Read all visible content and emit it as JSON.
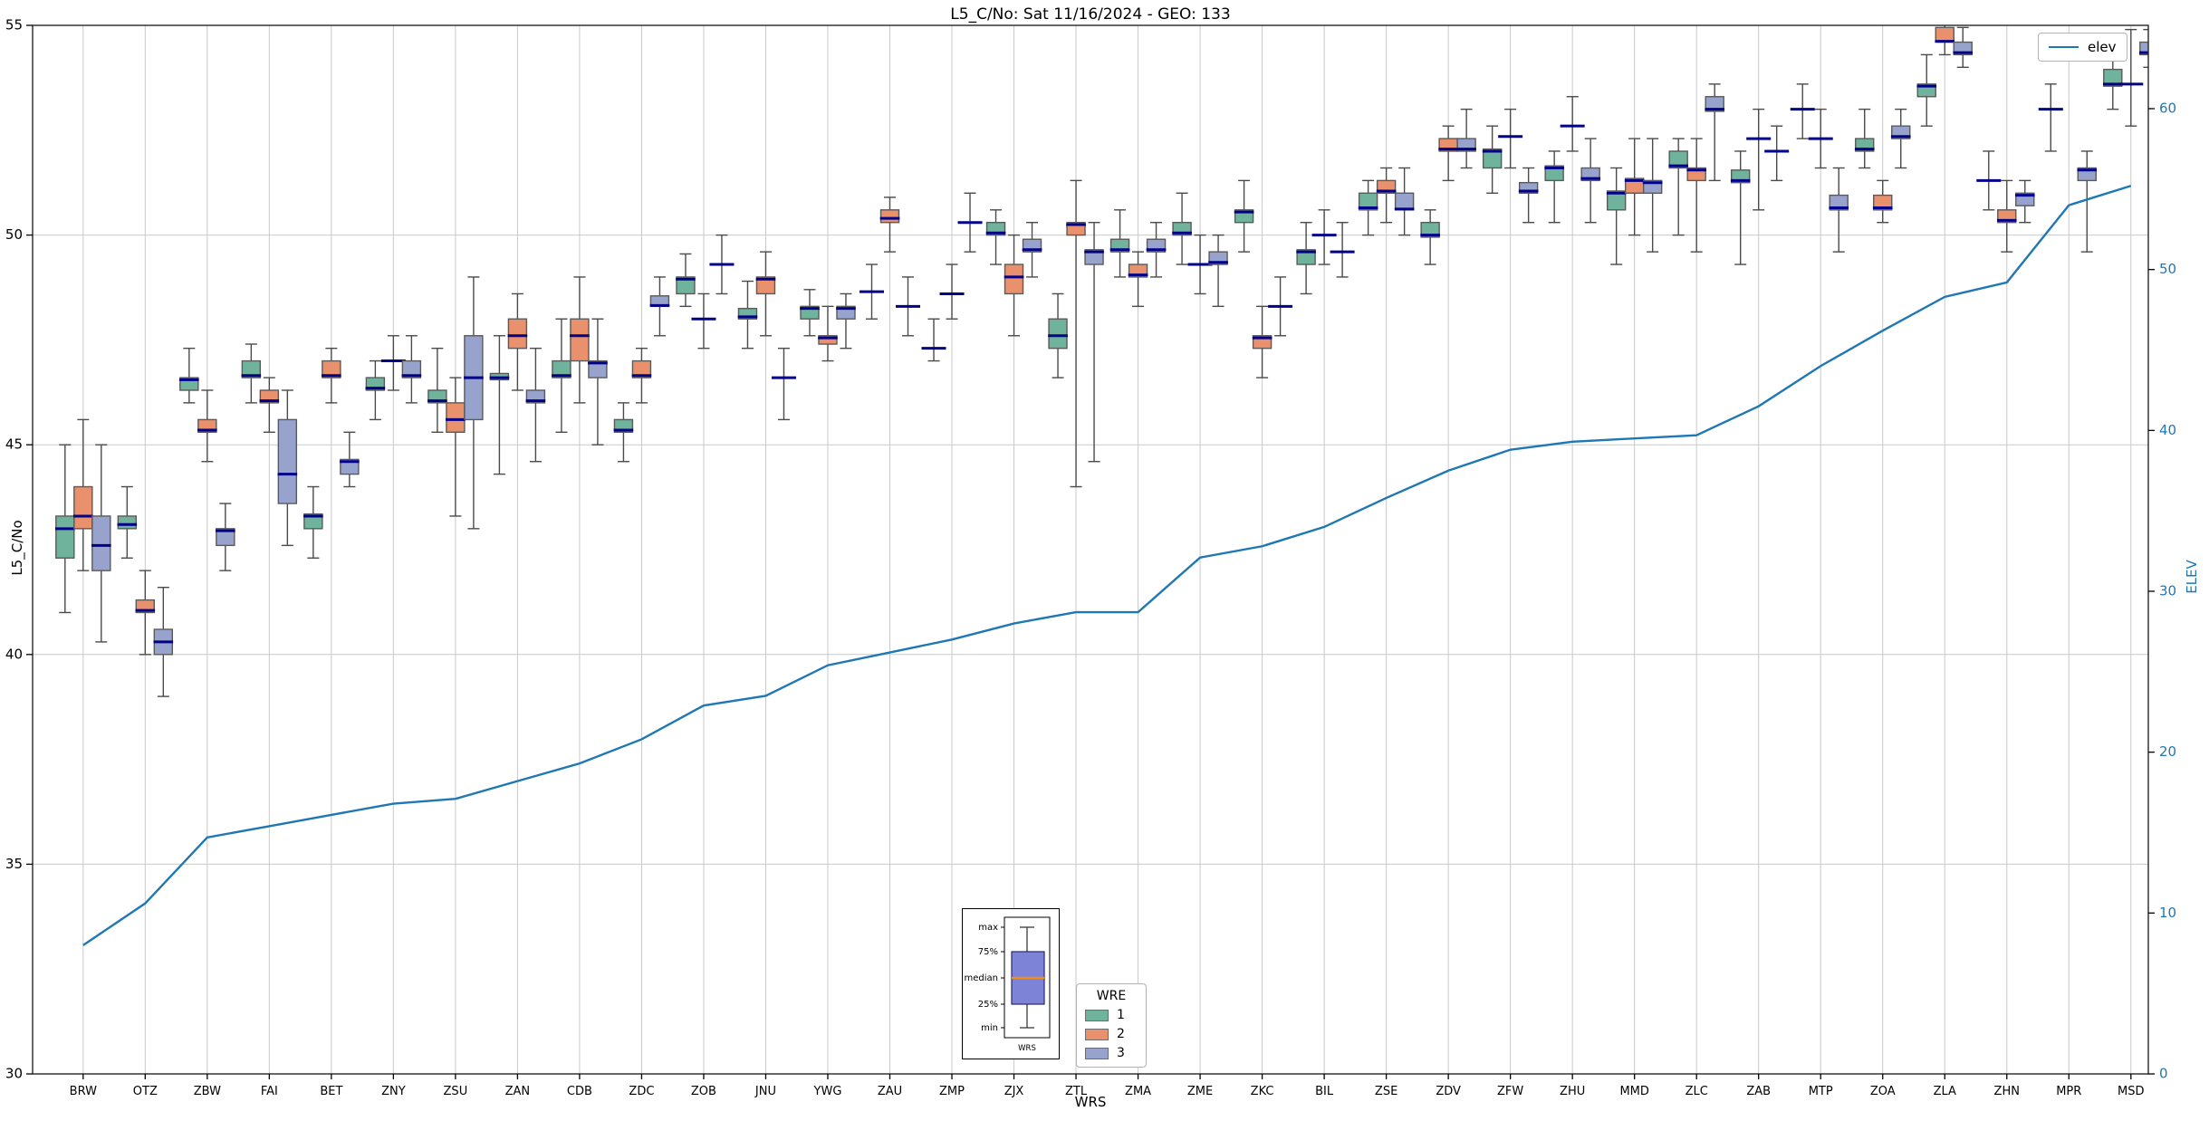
{
  "title": "L5_C/No: Sat 11/16/2024 - GEO: 133",
  "axes": {
    "y_left": {
      "label": "L5_C/No",
      "min": 30,
      "max": 55,
      "ticks": [
        30,
        35,
        40,
        45,
        50,
        55
      ],
      "gridlines": [
        35,
        40,
        45,
        50
      ],
      "tick_color": "#000000"
    },
    "y_right": {
      "label": "ELEV",
      "min": 0,
      "max": 65,
      "ticks": [
        0,
        10,
        20,
        30,
        40,
        50,
        60
      ],
      "tick_color": "#1f77b4"
    },
    "x": {
      "label": "WRS"
    }
  },
  "legend_elev": {
    "label": "elev"
  },
  "legend_wre": {
    "title": "WRE",
    "items": [
      {
        "label": "1",
        "color": "#6fb39c"
      },
      {
        "label": "2",
        "color": "#e8916c"
      },
      {
        "label": "3",
        "color": "#97a3cd"
      }
    ]
  },
  "inset_key": {
    "labels": [
      "max",
      "75%",
      "median",
      "25%",
      "min"
    ],
    "xlabel": "WRS",
    "box_color": "#7d83d7",
    "median_color": "#ef8c1a"
  },
  "chart_data": {
    "type": "box",
    "title": "L5_C/No: Sat 11/16/2024 - GEO: 133",
    "xlabel": "WRS",
    "ylabel": "L5_C/No",
    "ylabel_right": "ELEV",
    "ylim": [
      30,
      55
    ],
    "ylim_right": [
      0,
      65
    ],
    "grid": true,
    "legend_position": "bottom-center",
    "stations": [
      "BRW",
      "OTZ",
      "ZBW",
      "FAI",
      "BET",
      "ZNY",
      "ZSU",
      "ZAN",
      "CDB",
      "ZDC",
      "ZOB",
      "JNU",
      "YWG",
      "ZAU",
      "ZMP",
      "ZJX",
      "ZTL",
      "ZMA",
      "ZME",
      "ZKC",
      "BIL",
      "ZSE",
      "ZDV",
      "ZFW",
      "ZHU",
      "MMD",
      "ZLC",
      "ZAB",
      "MTP",
      "ZOA",
      "ZLA",
      "ZHN",
      "MPR",
      "MSD"
    ],
    "box_value_order": [
      "min",
      "q1",
      "median",
      "q3",
      "max"
    ],
    "series": [
      {
        "name": "1",
        "color": "#6fb39c",
        "boxes": [
          [
            41.0,
            42.3,
            43.0,
            43.3,
            45.0
          ],
          [
            42.3,
            43.0,
            43.1,
            43.3,
            44.0
          ],
          [
            46.0,
            46.3,
            46.55,
            46.6,
            47.3
          ],
          [
            46.0,
            46.6,
            46.65,
            47.0,
            47.4
          ],
          [
            42.3,
            43.0,
            43.3,
            43.35,
            44.0
          ],
          [
            45.6,
            46.3,
            46.35,
            46.6,
            47.0
          ],
          [
            45.3,
            46.0,
            46.05,
            46.3,
            47.3
          ],
          [
            44.3,
            46.55,
            46.6,
            46.7,
            47.6
          ],
          [
            45.3,
            46.6,
            46.65,
            47.0,
            48.0
          ],
          [
            44.6,
            45.3,
            45.35,
            45.6,
            46.0
          ],
          [
            48.3,
            48.6,
            48.95,
            49.0,
            49.55
          ],
          [
            47.3,
            48.0,
            48.05,
            48.25,
            48.9
          ],
          [
            47.6,
            48.0,
            48.25,
            48.3,
            48.7
          ],
          [
            48.0,
            48.65,
            48.65,
            48.65,
            49.3
          ],
          [
            47.0,
            47.3,
            47.3,
            47.3,
            48.0
          ],
          [
            49.3,
            50.0,
            50.05,
            50.3,
            50.6
          ],
          [
            46.6,
            47.3,
            47.6,
            48.0,
            48.6
          ],
          [
            49.0,
            49.6,
            49.65,
            49.9,
            50.6
          ],
          [
            49.3,
            50.0,
            50.05,
            50.3,
            51.0
          ],
          [
            49.6,
            50.3,
            50.55,
            50.6,
            51.3
          ],
          [
            48.6,
            49.3,
            49.6,
            49.65,
            50.3
          ],
          [
            50.0,
            50.6,
            50.65,
            51.0,
            51.3
          ],
          [
            49.3,
            49.95,
            50.0,
            50.3,
            50.6
          ],
          [
            51.0,
            51.6,
            52.0,
            52.05,
            52.6
          ],
          [
            50.3,
            51.3,
            51.6,
            51.65,
            52.0
          ],
          [
            49.3,
            50.6,
            51.0,
            51.05,
            51.6
          ],
          [
            50.0,
            51.6,
            51.65,
            52.0,
            52.3
          ],
          [
            49.3,
            51.25,
            51.3,
            51.55,
            52.0
          ],
          [
            52.3,
            53.0,
            53.0,
            53.0,
            53.6
          ],
          [
            51.6,
            52.0,
            52.05,
            52.3,
            53.0
          ],
          [
            52.6,
            53.3,
            53.55,
            53.6,
            54.3
          ],
          [
            50.6,
            51.3,
            51.3,
            51.3,
            52.0
          ],
          [
            52.0,
            53.0,
            53.0,
            53.0,
            53.6
          ],
          [
            53.0,
            53.55,
            53.6,
            53.95,
            54.3
          ]
        ]
      },
      {
        "name": "2",
        "color": "#e8916c",
        "boxes": [
          [
            42.0,
            43.0,
            43.3,
            44.0,
            45.6
          ],
          [
            40.0,
            41.0,
            41.05,
            41.3,
            42.0
          ],
          [
            44.6,
            45.3,
            45.35,
            45.6,
            46.3
          ],
          [
            45.3,
            46.0,
            46.05,
            46.3,
            46.6
          ],
          [
            46.0,
            46.6,
            46.65,
            47.0,
            47.3
          ],
          [
            46.3,
            47.0,
            47.0,
            47.0,
            47.6
          ],
          [
            43.3,
            45.3,
            45.6,
            46.0,
            46.6
          ],
          [
            46.3,
            47.3,
            47.6,
            48.0,
            48.6
          ],
          [
            46.0,
            47.0,
            47.6,
            48.0,
            49.0
          ],
          [
            46.0,
            46.6,
            46.65,
            47.0,
            47.3
          ],
          [
            47.3,
            48.0,
            48.0,
            48.0,
            48.6
          ],
          [
            47.6,
            48.6,
            48.95,
            49.0,
            49.6
          ],
          [
            47.0,
            47.4,
            47.55,
            47.6,
            48.3
          ],
          [
            49.6,
            50.3,
            50.4,
            50.6,
            50.9
          ],
          [
            48.0,
            48.6,
            48.6,
            48.6,
            49.3
          ],
          [
            47.6,
            48.6,
            49.0,
            49.3,
            50.0
          ],
          [
            44.0,
            50.0,
            50.25,
            50.3,
            51.3
          ],
          [
            48.3,
            49.0,
            49.05,
            49.3,
            49.6
          ],
          [
            48.6,
            49.3,
            49.3,
            49.3,
            50.0
          ],
          [
            46.6,
            47.3,
            47.55,
            47.6,
            48.3
          ],
          [
            49.3,
            50.0,
            50.0,
            50.0,
            50.6
          ],
          [
            50.3,
            51.0,
            51.05,
            51.3,
            51.6
          ],
          [
            51.3,
            52.0,
            52.05,
            52.3,
            52.6
          ],
          [
            51.6,
            52.35,
            52.35,
            52.35,
            53.0
          ],
          [
            52.0,
            52.6,
            52.6,
            52.6,
            53.3
          ],
          [
            50.0,
            51.0,
            51.3,
            51.35,
            52.3
          ],
          [
            49.6,
            51.3,
            51.55,
            51.6,
            52.3
          ],
          [
            50.6,
            52.3,
            52.3,
            52.3,
            53.0
          ],
          [
            51.6,
            52.3,
            52.3,
            52.3,
            53.0
          ],
          [
            50.3,
            50.6,
            50.65,
            50.95,
            51.3
          ],
          [
            54.3,
            54.6,
            54.62,
            54.95,
            55.2
          ],
          [
            49.6,
            50.3,
            50.35,
            50.6,
            51.3
          ],
          null,
          [
            52.6,
            53.6,
            53.6,
            53.6,
            54.9
          ]
        ]
      },
      {
        "name": "3",
        "color": "#97a3cd",
        "boxes": [
          [
            40.3,
            42.0,
            42.6,
            43.3,
            45.0
          ],
          [
            39.0,
            40.0,
            40.3,
            40.6,
            41.6
          ],
          [
            42.0,
            42.6,
            42.95,
            43.0,
            43.6
          ],
          [
            42.6,
            43.6,
            44.3,
            45.6,
            46.3
          ],
          [
            44.0,
            44.3,
            44.6,
            44.65,
            45.3
          ],
          [
            46.0,
            46.6,
            46.65,
            47.0,
            47.6
          ],
          [
            43.0,
            45.6,
            46.6,
            47.6,
            49.0
          ],
          [
            44.6,
            46.0,
            46.05,
            46.3,
            47.3
          ],
          [
            45.0,
            46.6,
            46.95,
            47.0,
            48.0
          ],
          [
            47.6,
            48.3,
            48.32,
            48.55,
            49.0
          ],
          [
            48.6,
            49.3,
            49.3,
            49.3,
            50.0
          ],
          [
            45.6,
            46.6,
            46.6,
            46.6,
            47.3
          ],
          [
            47.3,
            48.0,
            48.25,
            48.3,
            48.6
          ],
          [
            47.6,
            48.3,
            48.3,
            48.3,
            49.0
          ],
          [
            49.6,
            50.3,
            50.3,
            50.3,
            51.0
          ],
          [
            49.0,
            49.6,
            49.65,
            49.9,
            50.3
          ],
          [
            44.6,
            49.3,
            49.6,
            49.65,
            50.3
          ],
          [
            49.0,
            49.6,
            49.65,
            49.9,
            50.3
          ],
          [
            48.3,
            49.3,
            49.35,
            49.6,
            50.0
          ],
          [
            47.6,
            48.3,
            48.3,
            48.3,
            49.0
          ],
          [
            49.0,
            49.6,
            49.6,
            49.6,
            50.3
          ],
          [
            50.0,
            50.6,
            50.62,
            51.0,
            51.6
          ],
          [
            51.6,
            52.0,
            52.05,
            52.3,
            53.0
          ],
          [
            50.3,
            51.0,
            51.05,
            51.25,
            51.6
          ],
          [
            50.3,
            51.3,
            51.35,
            51.6,
            52.3
          ],
          [
            49.6,
            51.0,
            51.25,
            51.3,
            52.3
          ],
          [
            51.3,
            52.95,
            53.0,
            53.3,
            53.6
          ],
          [
            51.3,
            52.0,
            52.0,
            52.0,
            52.6
          ],
          [
            49.6,
            50.6,
            50.65,
            50.95,
            51.6
          ],
          [
            51.6,
            52.3,
            52.35,
            52.6,
            53.0
          ],
          [
            54.0,
            54.3,
            54.35,
            54.6,
            54.95
          ],
          [
            50.3,
            50.7,
            50.95,
            51.0,
            51.3
          ],
          [
            49.6,
            51.3,
            51.55,
            51.6,
            52.0
          ],
          [
            54.0,
            54.3,
            54.35,
            54.6,
            54.9
          ]
        ]
      }
    ],
    "elev_series": {
      "name": "elev",
      "color": "#1f77b4",
      "values": [
        8.0,
        10.6,
        14.7,
        15.4,
        16.1,
        16.8,
        17.1,
        18.2,
        19.3,
        20.8,
        22.9,
        23.5,
        25.4,
        26.2,
        27.0,
        28.0,
        28.7,
        28.7,
        32.1,
        32.8,
        34.0,
        35.8,
        37.5,
        38.8,
        39.3,
        39.5,
        39.7,
        41.5,
        44.0,
        46.2,
        48.3,
        49.2,
        54.0,
        55.2
      ]
    },
    "style": {
      "median_color": "#00008b",
      "box_edge_color": "#5a5a5a",
      "whisker_color": "#4a4a4a",
      "gridline_color": "#c9c9c9",
      "spine_color": "#262626"
    }
  }
}
